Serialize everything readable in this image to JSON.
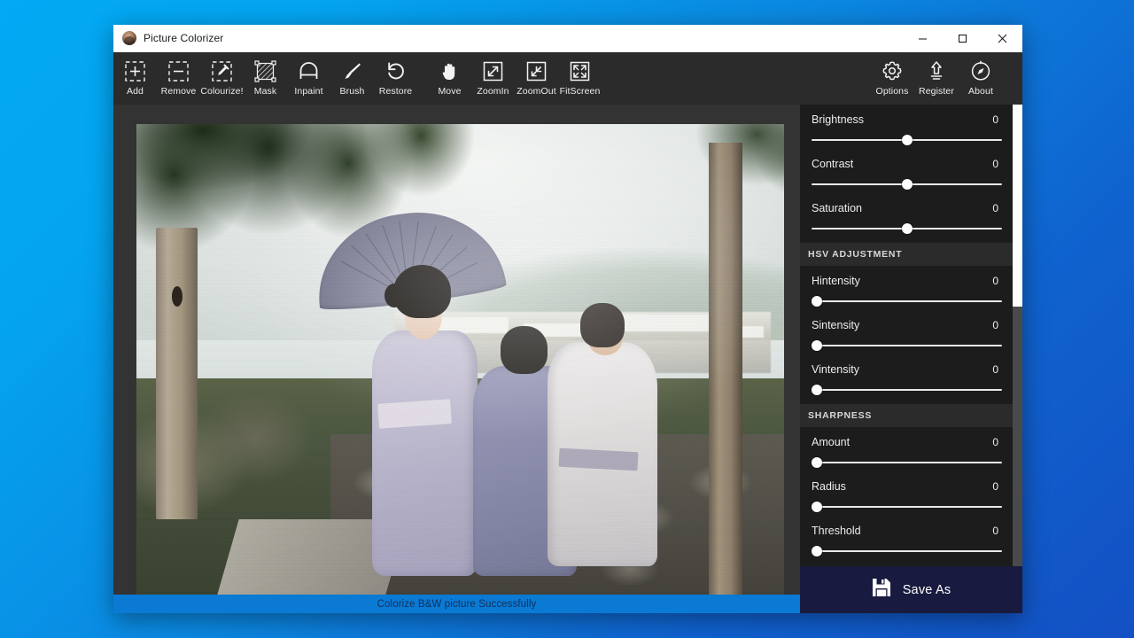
{
  "window": {
    "title": "Picture Colorizer",
    "app_icon": "portrait-avatar-icon",
    "controls": {
      "minimize": "minimize-icon",
      "maximize": "maximize-icon",
      "close": "close-icon"
    }
  },
  "toolbar": {
    "left_tools": [
      {
        "label": "Add",
        "icon": "add-dashed-box-icon"
      },
      {
        "label": "Remove",
        "icon": "remove-dashed-box-icon"
      },
      {
        "label": "Colourize!",
        "icon": "eyedropper-dashed-box-icon"
      },
      {
        "label": "Mask",
        "icon": "mask-hatched-square-icon"
      },
      {
        "label": "Inpaint",
        "icon": "inpaint-roller-icon"
      },
      {
        "label": "Brush",
        "icon": "paintbrush-icon"
      },
      {
        "label": "Restore",
        "icon": "undo-arrow-icon"
      },
      {
        "label": "Move",
        "icon": "hand-icon"
      },
      {
        "label": "ZoomIn",
        "icon": "zoom-in-icon"
      },
      {
        "label": "ZoomOut",
        "icon": "zoom-out-icon"
      },
      {
        "label": "FitScreen",
        "icon": "fit-screen-icon"
      }
    ],
    "right_tools": [
      {
        "label": "Options",
        "icon": "gear-icon"
      },
      {
        "label": "Register",
        "icon": "upload-arrow-icon"
      },
      {
        "label": "About",
        "icon": "compass-icon"
      }
    ]
  },
  "canvas": {
    "image_description": "Colorized vintage photograph of three people in kimonos by a misty lake with a parasol",
    "background_color": "#333333"
  },
  "panel": {
    "sections": [
      {
        "header": null,
        "sliders": [
          {
            "name": "Brightness",
            "value": "0",
            "position": 50
          },
          {
            "name": "Contrast",
            "value": "0",
            "position": 50
          },
          {
            "name": "Saturation",
            "value": "0",
            "position": 50
          }
        ]
      },
      {
        "header": "HSV ADJUSTMENT",
        "sliders": [
          {
            "name": "Hintensity",
            "value": "0",
            "position": 0
          },
          {
            "name": "Sintensity",
            "value": "0",
            "position": 0
          },
          {
            "name": "Vintensity",
            "value": "0",
            "position": 0
          }
        ]
      },
      {
        "header": "SHARPNESS",
        "sliders": [
          {
            "name": "Amount",
            "value": "0",
            "position": 0
          },
          {
            "name": "Radius",
            "value": "0",
            "position": 0
          },
          {
            "name": "Threshold",
            "value": "0",
            "position": 0
          }
        ]
      }
    ],
    "scrollbar": {
      "thumb_top_pct": 0,
      "thumb_height_pct": 42
    }
  },
  "save": {
    "label": "Save As",
    "icon": "floppy-disk-icon",
    "background_color": "#191a3f"
  },
  "status": {
    "text": "Colorize B&W picture Successfully",
    "background_color": "#0a7ad4",
    "text_color": "#11305c"
  },
  "desktop": {
    "background_start": "#03a9f4",
    "background_end": "#1350c4"
  }
}
